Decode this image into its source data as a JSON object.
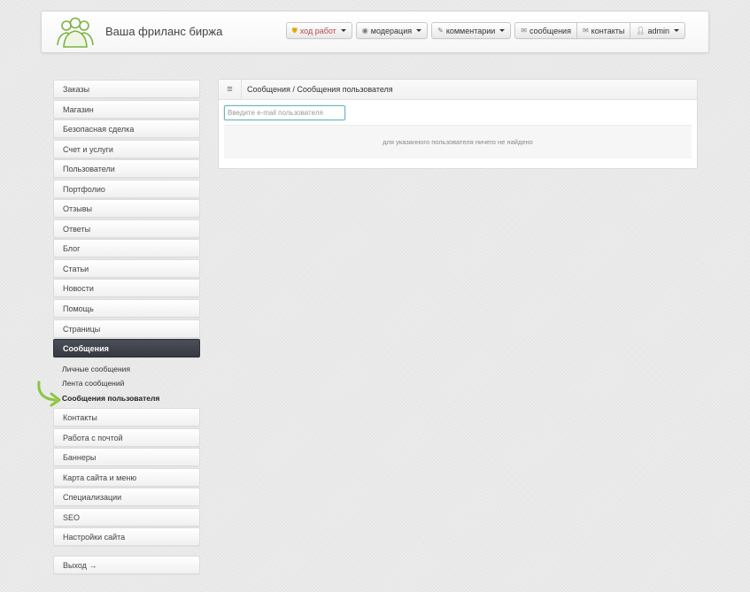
{
  "header": {
    "brand": "Ваша фриланс биржа",
    "nav": [
      {
        "label": "ход работ",
        "icon": "shield-icon",
        "has_caret": true,
        "warn": true
      },
      {
        "label": "модерация",
        "icon": "eye-icon",
        "has_caret": true
      },
      {
        "label": "комментарии",
        "icon": "pencil-icon",
        "has_caret": true
      },
      {
        "label": "сообщения",
        "icon": "envelope-icon",
        "has_caret": false
      },
      {
        "label": "контакты",
        "icon": "envelope-icon",
        "has_caret": false
      },
      {
        "label": "admin",
        "icon": "user-icon",
        "has_caret": true
      }
    ]
  },
  "sidebar": {
    "items": [
      "Заказы",
      "Магазин",
      "Безопасная сделка",
      "Счет и услуги",
      "Пользователи",
      "Портфолио",
      "Отзывы",
      "Ответы",
      "Блог",
      "Статьи",
      "Новости",
      "Помощь",
      "Страницы",
      "Сообщения",
      "Контакты",
      "Работа с почтой",
      "Баннеры",
      "Карта сайта и меню",
      "Специализации",
      "SEO",
      "Настройки сайта"
    ],
    "active": "Сообщения",
    "submenu": [
      "Личные сообщения",
      "Лента сообщений",
      "Сообщения пользователя"
    ],
    "submenu_current": "Сообщения пользователя",
    "logout": "Выход →"
  },
  "main": {
    "breadcrumb": "Сообщения / Сообщения пользователя",
    "search_placeholder": "Введите e-mail пользователя",
    "search_value": "",
    "empty_text": "для указанного пользователя ничего не найдено"
  },
  "colors": {
    "accent_arrow": "#8cc63f",
    "active_bg": "#3f444b",
    "warn_text": "#b94a48"
  }
}
